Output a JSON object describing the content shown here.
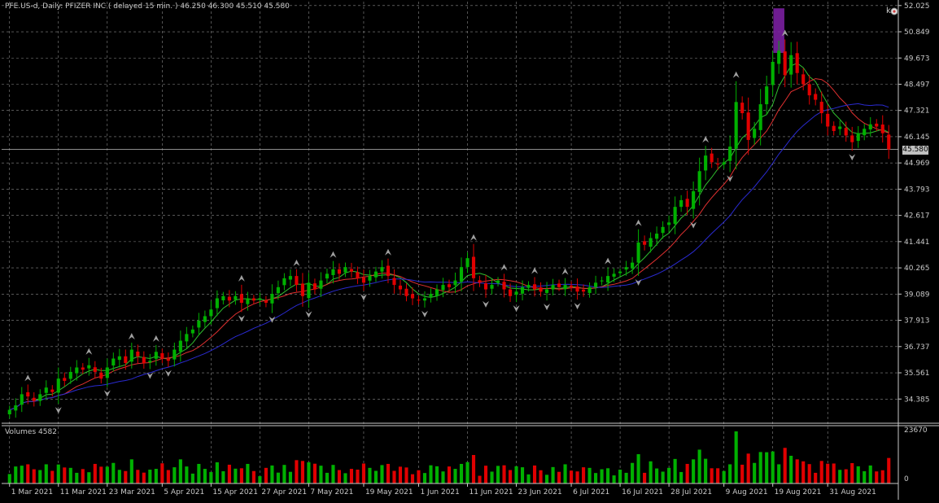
{
  "header": {
    "symbol_line": "PFE.US-d, Daily:  PFIZER INC ( delayed 15 min. )  46.250 46.300 45.510 45.580"
  },
  "volume_panel": {
    "label": "Volumes 4582"
  },
  "last_price_label": "45.580",
  "colors": {
    "background": "#000000",
    "grid": "#8a8a8a",
    "bull": "#00b000",
    "bear": "#e00000",
    "ma_fast": "#2fbf2f",
    "ma_mid": "#e03030",
    "ma_slow": "#2a2ad0",
    "fractal": "#a0a0a0",
    "highlight": "#7a1fa0",
    "text": "#c8c8c8"
  },
  "chart_data": [
    {
      "type": "candlestick",
      "title": "PFE.US-d, Daily:  PFIZER INC ( delayed 15 min. )",
      "ohlc_current": [
        46.25,
        46.3,
        45.51,
        45.58
      ],
      "y_ticks": [
        "52.025",
        "50.849",
        "49.673",
        "48.497",
        "47.321",
        "46.145",
        "44.969",
        "43.793",
        "42.617",
        "41.441",
        "40.265",
        "39.089",
        "37.913",
        "36.737",
        "35.561",
        "34.385"
      ],
      "ylim": [
        33.3,
        52.2
      ],
      "x_tick_labels": [
        "1 Mar 2021",
        "11 Mar 2021",
        "23 Mar 2021",
        "5 Apr 2021",
        "15 Apr 2021",
        "27 Apr 2021",
        "7 May 2021",
        "19 May 2021",
        "1 Jun 2021",
        "11 Jun 2021",
        "23 Jun 2021",
        "6 Jul 2021",
        "16 Jul 2021",
        "28 Jul 2021",
        "9 Aug 2021",
        "19 Aug 2021",
        "31 Aug 2021"
      ],
      "x_tick_index": [
        0,
        8,
        16,
        25,
        33,
        41,
        49,
        58,
        67,
        75,
        83,
        92,
        100,
        108,
        117,
        125,
        134
      ],
      "closes": [
        33.9,
        34.1,
        34.6,
        34.5,
        34.3,
        34.6,
        34.9,
        34.7,
        35.3,
        35.2,
        35.6,
        35.8,
        35.7,
        35.9,
        35.6,
        35.3,
        35.8,
        36.2,
        36.3,
        36.0,
        36.6,
        36.3,
        36.0,
        36.1,
        36.5,
        36.2,
        36.1,
        36.6,
        37.0,
        37.3,
        37.5,
        37.9,
        38.1,
        38.4,
        38.9,
        39.0,
        38.8,
        39.0,
        38.7,
        38.9,
        38.8,
        38.9,
        38.7,
        39.1,
        39.4,
        39.8,
        39.9,
        39.5,
        39.0,
        39.6,
        39.3,
        39.7,
        40.0,
        40.2,
        40.0,
        40.3,
        40.1,
        39.8,
        39.6,
        39.9,
        40.1,
        40.3,
        39.9,
        39.5,
        39.3,
        39.0,
        38.9,
        38.8,
        38.9,
        39.1,
        39.3,
        39.5,
        39.4,
        39.7,
        40.3,
        40.7,
        39.8,
        39.6,
        39.3,
        39.5,
        39.7,
        39.3,
        39.0,
        39.2,
        39.4,
        39.5,
        39.3,
        39.2,
        39.3,
        39.5,
        39.4,
        39.5,
        39.4,
        39.2,
        39.2,
        39.4,
        39.6,
        39.7,
        39.9,
        40.0,
        40.1,
        40.3,
        40.5,
        41.4,
        41.3,
        41.6,
        41.8,
        42.1,
        42.3,
        43.0,
        43.3,
        43.0,
        43.7,
        44.6,
        45.3,
        45.0,
        44.9,
        45.0,
        45.7,
        47.7,
        47.2,
        46.0,
        46.5,
        47.6,
        48.4,
        49.5,
        50.0,
        48.9,
        49.8,
        49.0,
        48.5,
        48.0,
        47.8,
        47.2,
        46.6,
        46.4,
        46.6,
        46.2,
        45.9,
        46.3,
        46.5,
        46.7,
        46.6,
        46.3,
        45.58
      ],
      "volume_ylim": [
        0,
        23670
      ],
      "volume_ticks": [
        "23670",
        "0"
      ],
      "ma_lines": [
        "fast (green)",
        "medium (red)",
        "slow (blue)"
      ]
    }
  ]
}
